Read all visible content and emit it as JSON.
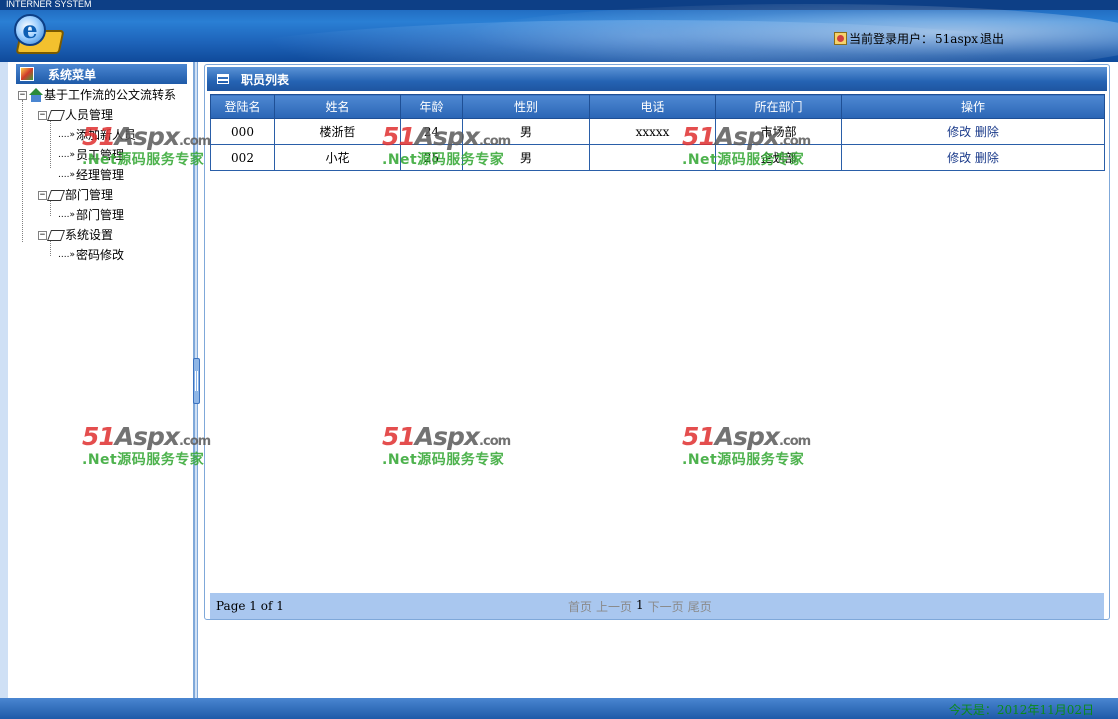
{
  "header": {
    "system_title": "INTERNER SYSTEM",
    "login_prefix": "当前登录用户：",
    "username": "51aspx",
    "logout_label": "退出"
  },
  "sidebar": {
    "title": "系统菜单",
    "root": "基于工作流的公文流转系",
    "groups": [
      {
        "label": "人员管理",
        "items": [
          "添加新人员",
          "员工管理",
          "经理管理"
        ]
      },
      {
        "label": "部门管理",
        "items": [
          "部门管理"
        ]
      },
      {
        "label": "系统设置",
        "items": [
          "密码修改"
        ]
      }
    ]
  },
  "main": {
    "panel_title": "职员列表",
    "columns": [
      "登陆名",
      "姓名",
      "年龄",
      "性别",
      "电话",
      "所在部门",
      "操作"
    ],
    "rows": [
      {
        "login": "000",
        "name": "楼浙哲",
        "age": "24",
        "gender": "男",
        "phone": "xxxxx",
        "dept": "市场部"
      },
      {
        "login": "002",
        "name": "小花",
        "age": "25",
        "gender": "男",
        "phone": "",
        "dept": "企划部"
      }
    ],
    "actions": {
      "edit": "修改",
      "delete": "删除"
    },
    "pager": {
      "info": "Page 1 of 1",
      "first": "首页",
      "prev": "上一页",
      "current": "1",
      "next": "下一页",
      "last": "尾页"
    }
  },
  "status": {
    "today": "今天是：2012年11月02日"
  },
  "watermark": {
    "brand_a": "51",
    "brand_b": "Aspx",
    "brand_c": ".com",
    "slogan": ".Net源码服务专家"
  }
}
